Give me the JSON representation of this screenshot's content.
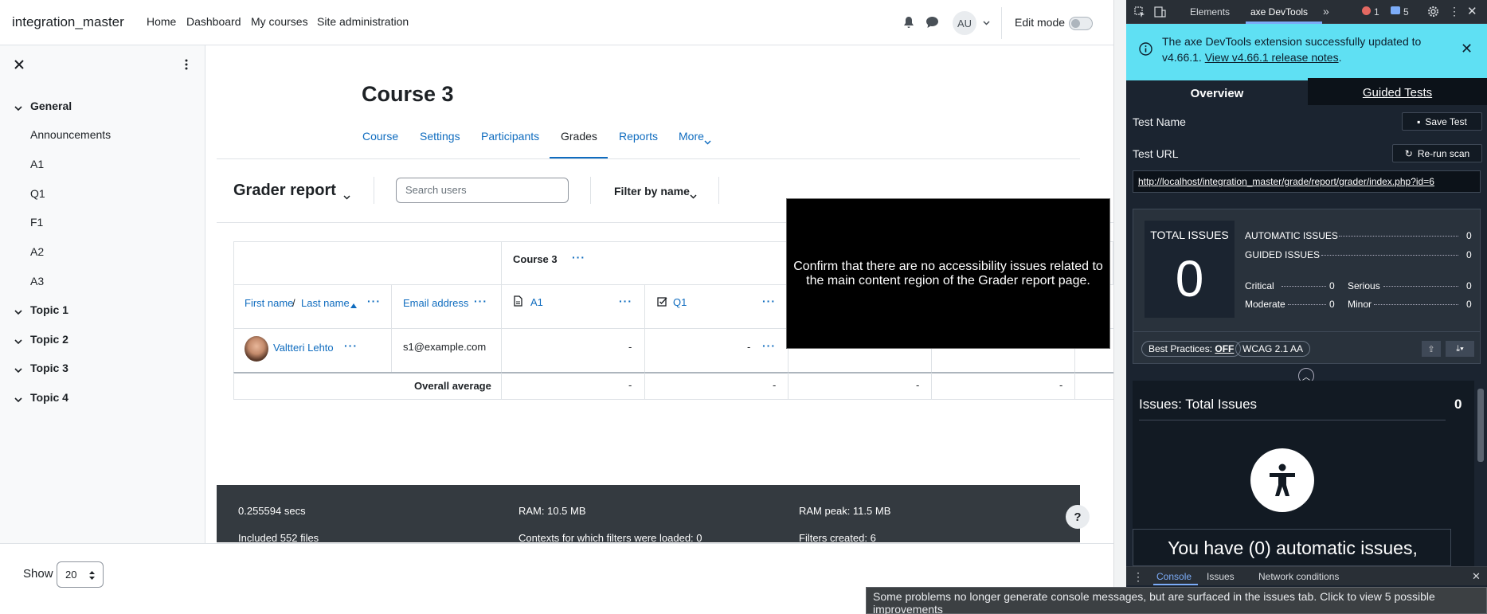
{
  "topnav": {
    "site_name": "integration_master",
    "links": [
      "Home",
      "Dashboard",
      "My courses",
      "Site administration"
    ],
    "user_initials": "AU",
    "edit_mode_label": "Edit mode"
  },
  "drawer": {
    "sections": [
      {
        "label": "General",
        "items": [
          "Announcements",
          "A1",
          "Q1",
          "F1",
          "A2",
          "A3"
        ]
      },
      {
        "label": "Topic 1"
      },
      {
        "label": "Topic 2"
      },
      {
        "label": "Topic 3"
      },
      {
        "label": "Topic 4"
      }
    ]
  },
  "course": {
    "title": "Course 3",
    "tabs": [
      "Course",
      "Settings",
      "Participants",
      "Grades",
      "Reports",
      "More"
    ],
    "active_tab": "Grades"
  },
  "grader": {
    "title": "Grader report",
    "search_placeholder": "Search users",
    "filter_label": "Filter by name",
    "category_header": "Course 3",
    "col_first_name": "First name",
    "col_separator": "/",
    "col_last_name": "Last name",
    "col_email": "Email address",
    "col_a1": "A1",
    "col_q1": "Q1",
    "row_user_name": "Valtteri Lehto",
    "row_email": "s1@example.com",
    "row_a1": "-",
    "row_q1": "-",
    "overall_label": "Overall average",
    "overall_values": [
      "-",
      "-",
      "-",
      "-"
    ]
  },
  "overlay": {
    "message": "Confirm that there are no accessibility issues related to the main content region of the Grader report page."
  },
  "footer": {
    "secs": "0.255594 secs",
    "ram": "RAM: 10.5 MB",
    "ram_peak": "RAM peak: 11.5 MB",
    "included_files": "Included 552 files",
    "contexts": "Contexts for which filters were loaded: 0",
    "filters_created": "Filters created: 6",
    "help": "?"
  },
  "bottombar": {
    "show_label": "Show",
    "show_value": "20"
  },
  "devtools": {
    "tabs": [
      "Elements",
      "axe DevTools"
    ],
    "error_count": "1",
    "message_count": "5",
    "banner_text": "The axe DevTools extension successfully updated to v4.66.1.",
    "banner_link": "View v4.66.1 release notes",
    "banner_suffix": ".",
    "subtabs": [
      "Overview",
      "Guided Tests"
    ],
    "test_name_label": "Test Name",
    "save_test": "Save Test",
    "test_url_label": "Test URL",
    "rerun_scan": "Re-run scan",
    "test_url": "http://localhost/integration_master/grade/report/grader/index.php?id=6",
    "total_issues_label": "TOTAL ISSUES",
    "total_issues": "0",
    "automatic_label": "AUTOMATIC ISSUES",
    "automatic_count": "0",
    "guided_label": "GUIDED ISSUES",
    "guided_count": "0",
    "critical_label": "Critical",
    "critical_count": "0",
    "serious_label": "Serious",
    "serious_count": "0",
    "moderate_label": "Moderate",
    "moderate_count": "0",
    "minor_label": "Minor",
    "minor_count": "0",
    "best_practices_label": "Best Practices:",
    "best_practices_value": "OFF",
    "wcag_label": "WCAG 2.1 AA",
    "issues_title": "Issues: Total Issues",
    "issues_count": "0",
    "no_issues_text": "You have (0) automatic issues,",
    "console_tabs": [
      "Console",
      "Issues",
      "Network conditions"
    ],
    "tooltip": "Some problems no longer generate console messages, but are surfaced in the issues tab. Click to view 5 possible improvements"
  },
  "colors": {
    "link": "#0f6cbf",
    "banner": "#5fe0f3",
    "devtools_bg": "#1b2430"
  }
}
